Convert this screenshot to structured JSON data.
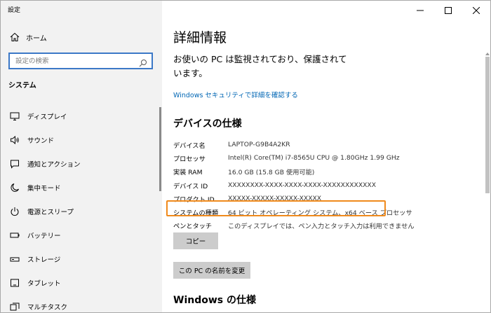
{
  "window": {
    "title": "設定",
    "controls": [
      "minimize",
      "maximize",
      "close"
    ]
  },
  "sidebar": {
    "home_label": "ホーム",
    "search_placeholder": "設定の検索",
    "section": "システム",
    "items": [
      {
        "label": "ディスプレイ",
        "icon": "monitor-icon"
      },
      {
        "label": "サウンド",
        "icon": "speaker-icon"
      },
      {
        "label": "通知とアクション",
        "icon": "notification-icon"
      },
      {
        "label": "集中モード",
        "icon": "moon-icon"
      },
      {
        "label": "電源とスリープ",
        "icon": "power-icon"
      },
      {
        "label": "バッテリー",
        "icon": "battery-icon"
      },
      {
        "label": "ストレージ",
        "icon": "storage-icon"
      },
      {
        "label": "タブレット",
        "icon": "tablet-icon"
      },
      {
        "label": "マルチタスク",
        "icon": "multitask-icon"
      }
    ]
  },
  "main": {
    "title": "詳細情報",
    "protection_status": "お使いの PC は監視されており、保護されています。",
    "security_link": "Windows セキュリティで詳細を確認する",
    "device_specs_heading": "デバイスの仕様",
    "specs": [
      {
        "label": "デバイス名",
        "value": "LAPTOP-G9B4A2KR"
      },
      {
        "label": "プロセッサ",
        "value": "Intel(R) Core(TM) i7-8565U CPU @ 1.80GHz   1.99 GHz"
      },
      {
        "label": "実装 RAM",
        "value": "16.0 GB (15.8 GB 使用可能)"
      },
      {
        "label": "デバイス ID",
        "value": "XXXXXXXX-XXXX-XXXX-XXXX-XXXXXXXXXXXX"
      },
      {
        "label": "プロダクト ID",
        "value": "XXXXX-XXXXX-XXXXX-XXXXX"
      },
      {
        "label": "システムの種類",
        "value": "64 ビット オペレーティング システム、x64 ベース プロセッサ"
      },
      {
        "label": "ペンとタッチ",
        "value": "このディスプレイでは、ペン入力とタッチ入力は利用できません"
      }
    ],
    "copy_button": "コピー",
    "rename_button": "この PC の名前を変更",
    "windows_specs_heading": "Windows の仕様"
  },
  "colors": {
    "highlight": "#f08a1c",
    "link": "#0066b4",
    "sidebar_bg": "#f2f2f2",
    "search_border": "#3b78c7"
  }
}
